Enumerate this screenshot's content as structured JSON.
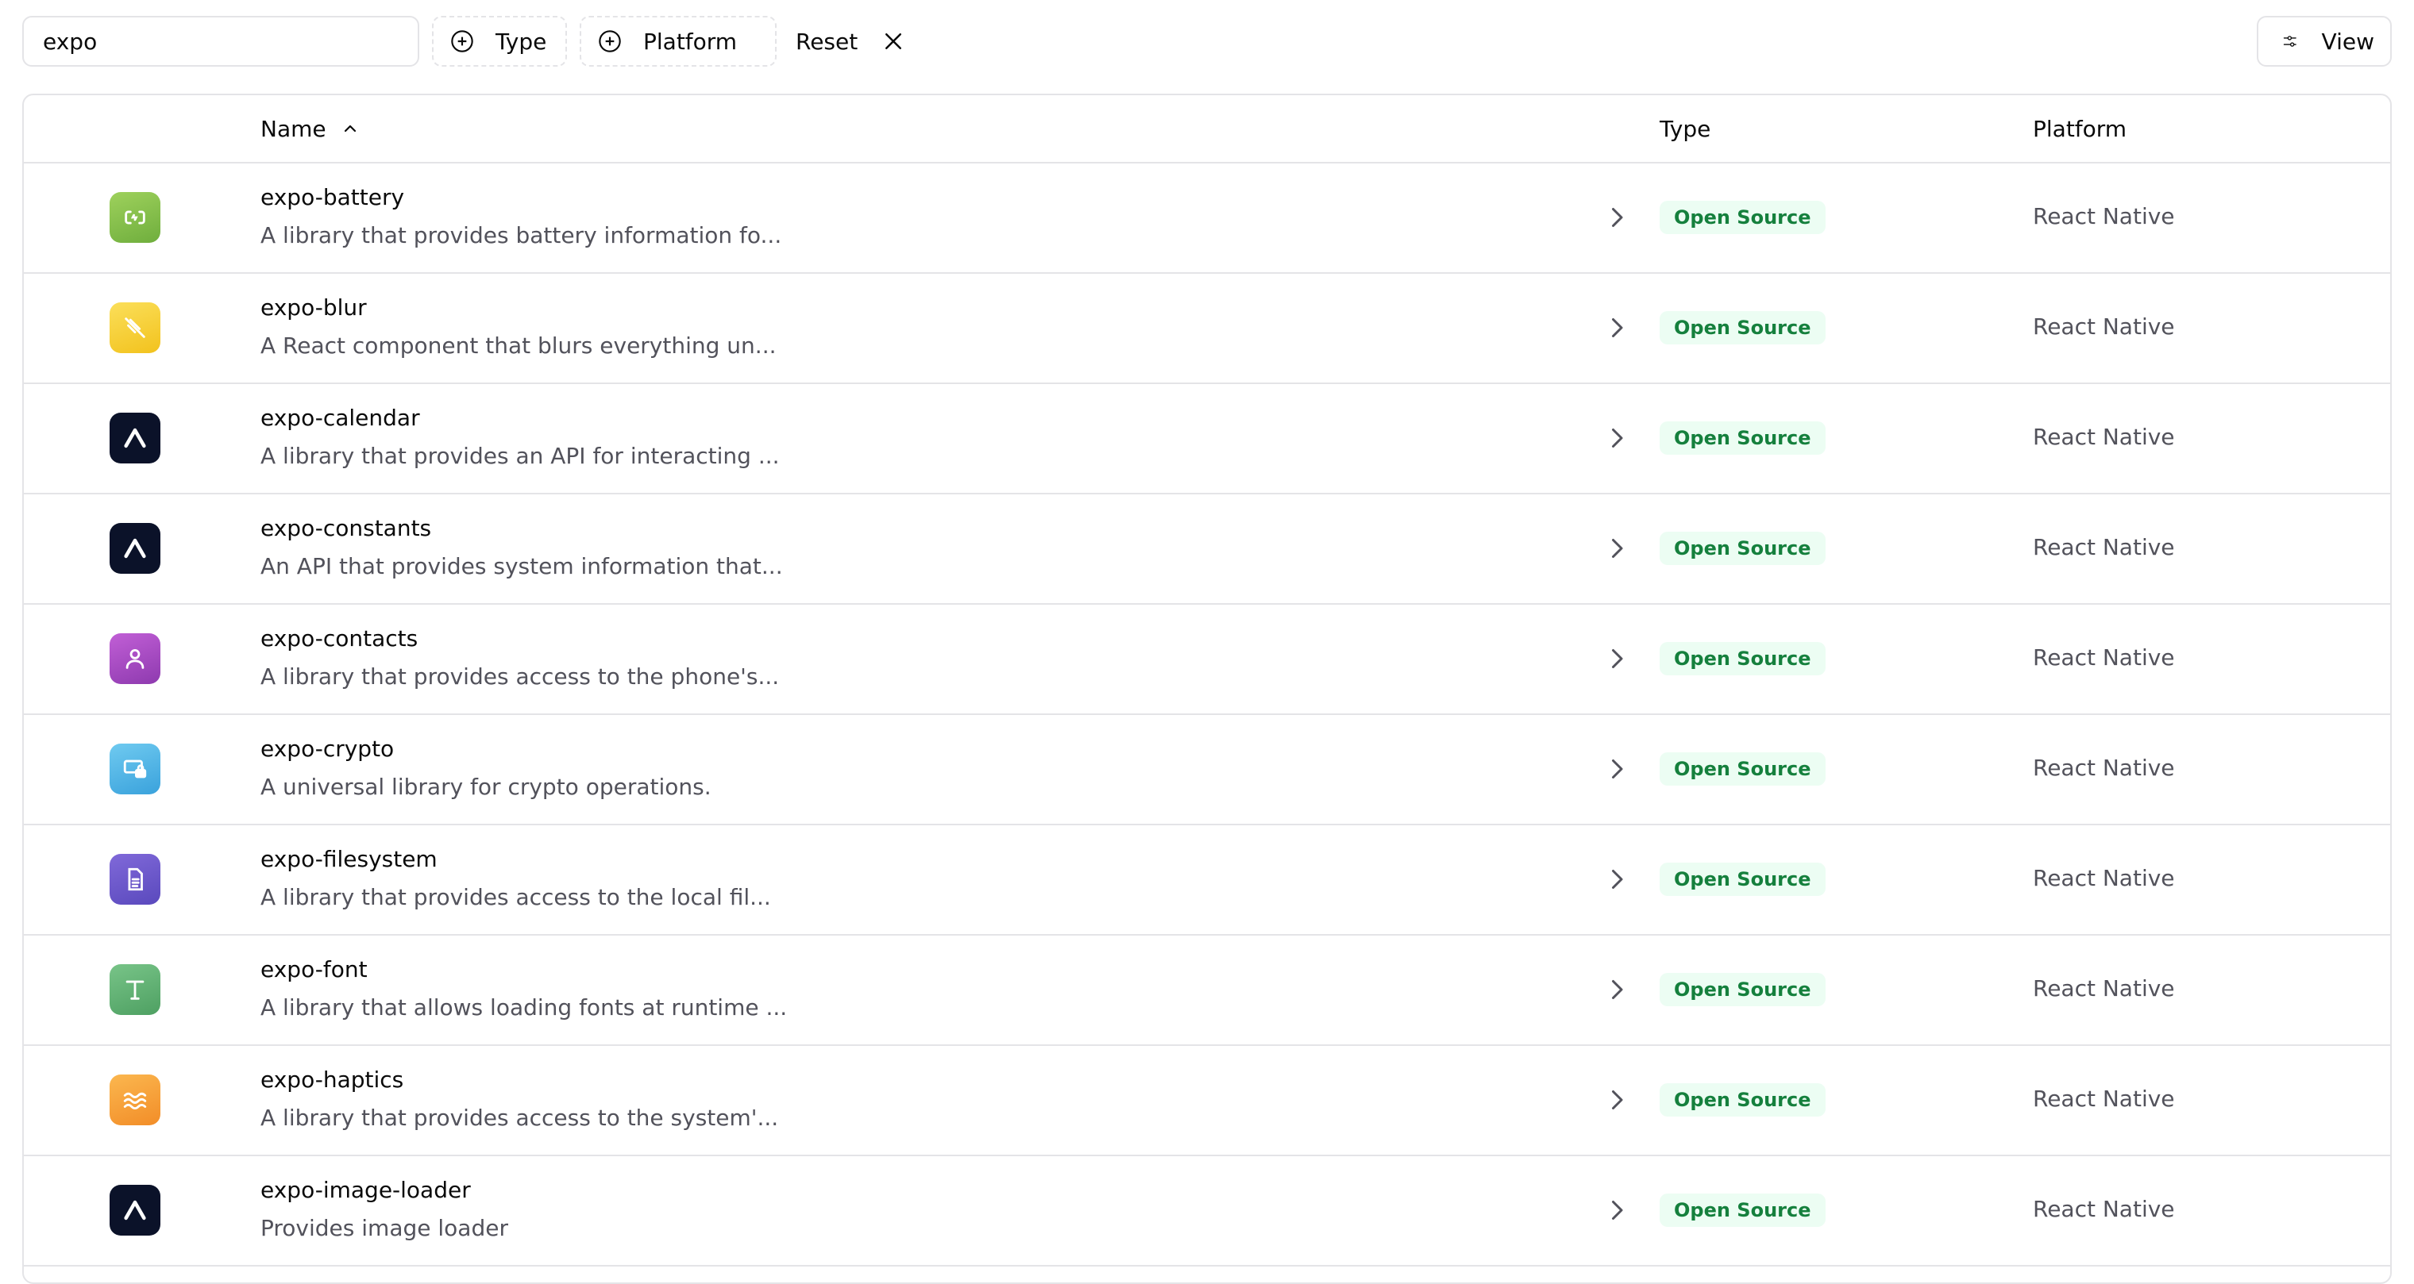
{
  "toolbar": {
    "search_value": "expo",
    "type_filter_label": "Type",
    "platform_filter_label": "Platform",
    "reset_label": "Reset",
    "view_label": "View"
  },
  "table": {
    "columns": {
      "name": "Name",
      "type": "Type",
      "platform": "Platform"
    },
    "rows": [
      {
        "title": "expo-battery",
        "description": "A library that provides battery information fo...",
        "type": "Open Source",
        "platform": "React Native",
        "icon": "battery-icon",
        "icon_bg": "#8bc34a"
      },
      {
        "title": "expo-blur",
        "description": "A React component that blurs everything un...",
        "type": "Open Source",
        "platform": "React Native",
        "icon": "blur-icon",
        "icon_bg": "#f7cf2e"
      },
      {
        "title": "expo-calendar",
        "description": "A library that provides an API for interacting ...",
        "type": "Open Source",
        "platform": "React Native",
        "icon": "expo-logo-icon",
        "icon_bg": "#0b1229"
      },
      {
        "title": "expo-constants",
        "description": "An API that provides system information that...",
        "type": "Open Source",
        "platform": "React Native",
        "icon": "expo-logo-icon",
        "icon_bg": "#0b1229"
      },
      {
        "title": "expo-contacts",
        "description": "A library that provides access to the phone's...",
        "type": "Open Source",
        "platform": "React Native",
        "icon": "contact-icon",
        "icon_bg": "#a94cc4"
      },
      {
        "title": "expo-crypto",
        "description": "A universal library for crypto operations.",
        "type": "Open Source",
        "platform": "React Native",
        "icon": "crypto-lock-icon",
        "icon_bg": "#4fb8e6"
      },
      {
        "title": "expo-filesystem",
        "description": "A library that provides access to the local fil...",
        "type": "Open Source",
        "platform": "React Native",
        "icon": "file-icon",
        "icon_bg": "#6a5acd"
      },
      {
        "title": "expo-font",
        "description": "A library that allows loading fonts at runtime ...",
        "type": "Open Source",
        "platform": "React Native",
        "icon": "font-t-icon",
        "icon_bg": "#5fb271"
      },
      {
        "title": "expo-haptics",
        "description": "A library that provides access to the system'...",
        "type": "Open Source",
        "platform": "React Native",
        "icon": "haptics-wave-icon",
        "icon_bg": "#f7a03a"
      },
      {
        "title": "expo-image-loader",
        "description": "Provides image loader",
        "type": "Open Source",
        "platform": "React Native",
        "icon": "expo-logo-icon",
        "icon_bg": "#0b1229"
      }
    ]
  }
}
